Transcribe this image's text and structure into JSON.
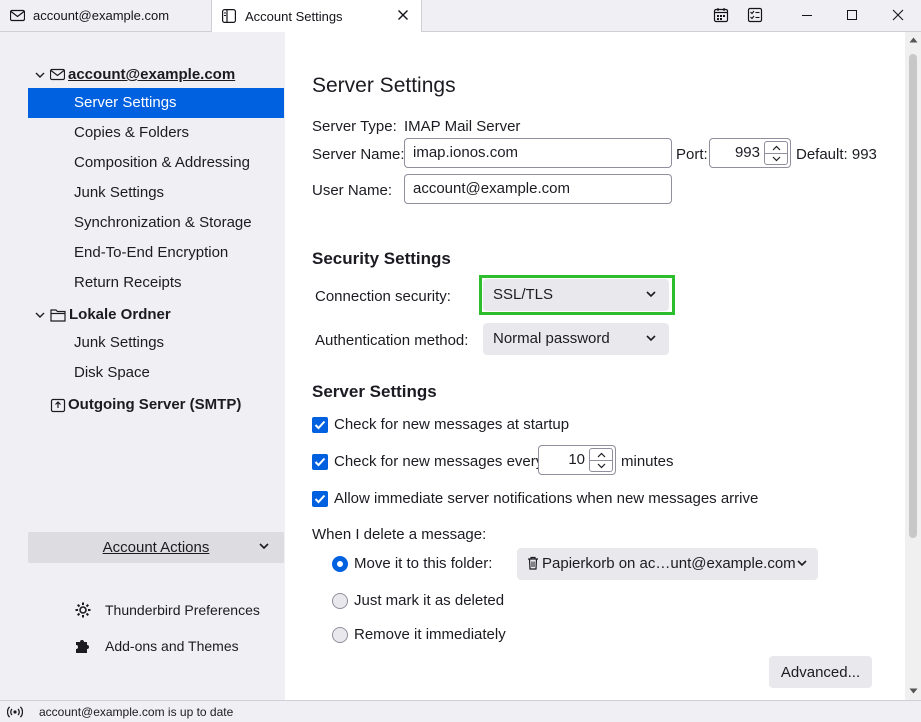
{
  "tabs": [
    {
      "label": "account@example.com",
      "icon": "mail-icon"
    },
    {
      "label": "Account Settings",
      "icon": "settings-page-icon",
      "close": "close-icon"
    }
  ],
  "toolbar_icons": [
    "calendar-icon",
    "tasks-icon"
  ],
  "sidebar": {
    "account": "account@example.com",
    "account_items": [
      "Server Settings",
      "Copies & Folders",
      "Composition & Addressing",
      "Junk Settings",
      "Synchronization & Storage",
      "End-To-End Encryption",
      "Return Receipts"
    ],
    "local_folders": "Lokale Ordner",
    "local_items": [
      "Junk Settings",
      "Disk Space"
    ],
    "outgoing": "Outgoing Server (SMTP)",
    "account_actions": "Account Actions",
    "preferences": "Thunderbird Preferences",
    "addons": "Add-ons and Themes"
  },
  "main": {
    "title": "Server Settings",
    "server_type_label": "Server Type:",
    "server_type_value": "IMAP Mail Server",
    "server_name_label": "Server Name:",
    "server_name_value": "imap.ionos.com",
    "port_label": "Port:",
    "port_value": "993",
    "default_port": "Default: 993",
    "user_name_label": "User Name:",
    "user_name_value": "account@example.com",
    "security_heading": "Security Settings",
    "connection_security_label": "Connection security:",
    "connection_security_value": "SSL/TLS",
    "auth_method_label": "Authentication method:",
    "auth_method_value": "Normal password",
    "server_settings_heading": "Server Settings",
    "check_startup": "Check for new messages at startup",
    "check_startup_checked": true,
    "check_every_prefix": "Check for new messages every",
    "check_every_value": "10",
    "check_every_suffix": "minutes",
    "check_every_checked": true,
    "allow_notifications": "Allow immediate server notifications when new messages arrive",
    "allow_notifications_checked": true,
    "delete_label": "When I delete a message:",
    "move_folder_label": "Move it to this folder:",
    "move_folder_value": "Papierkorb on ac…unt@example.com",
    "mark_deleted_label": "Just mark it as deleted",
    "remove_immediately_label": "Remove it immediately",
    "selected_delete_option": "move",
    "advanced_button": "Advanced..."
  },
  "status": {
    "text": "account@example.com is up to date"
  },
  "colors": {
    "accent": "#0061e0",
    "highlight_box": "#2dbd2d",
    "sidebar_bg": "#f0f0f4"
  }
}
